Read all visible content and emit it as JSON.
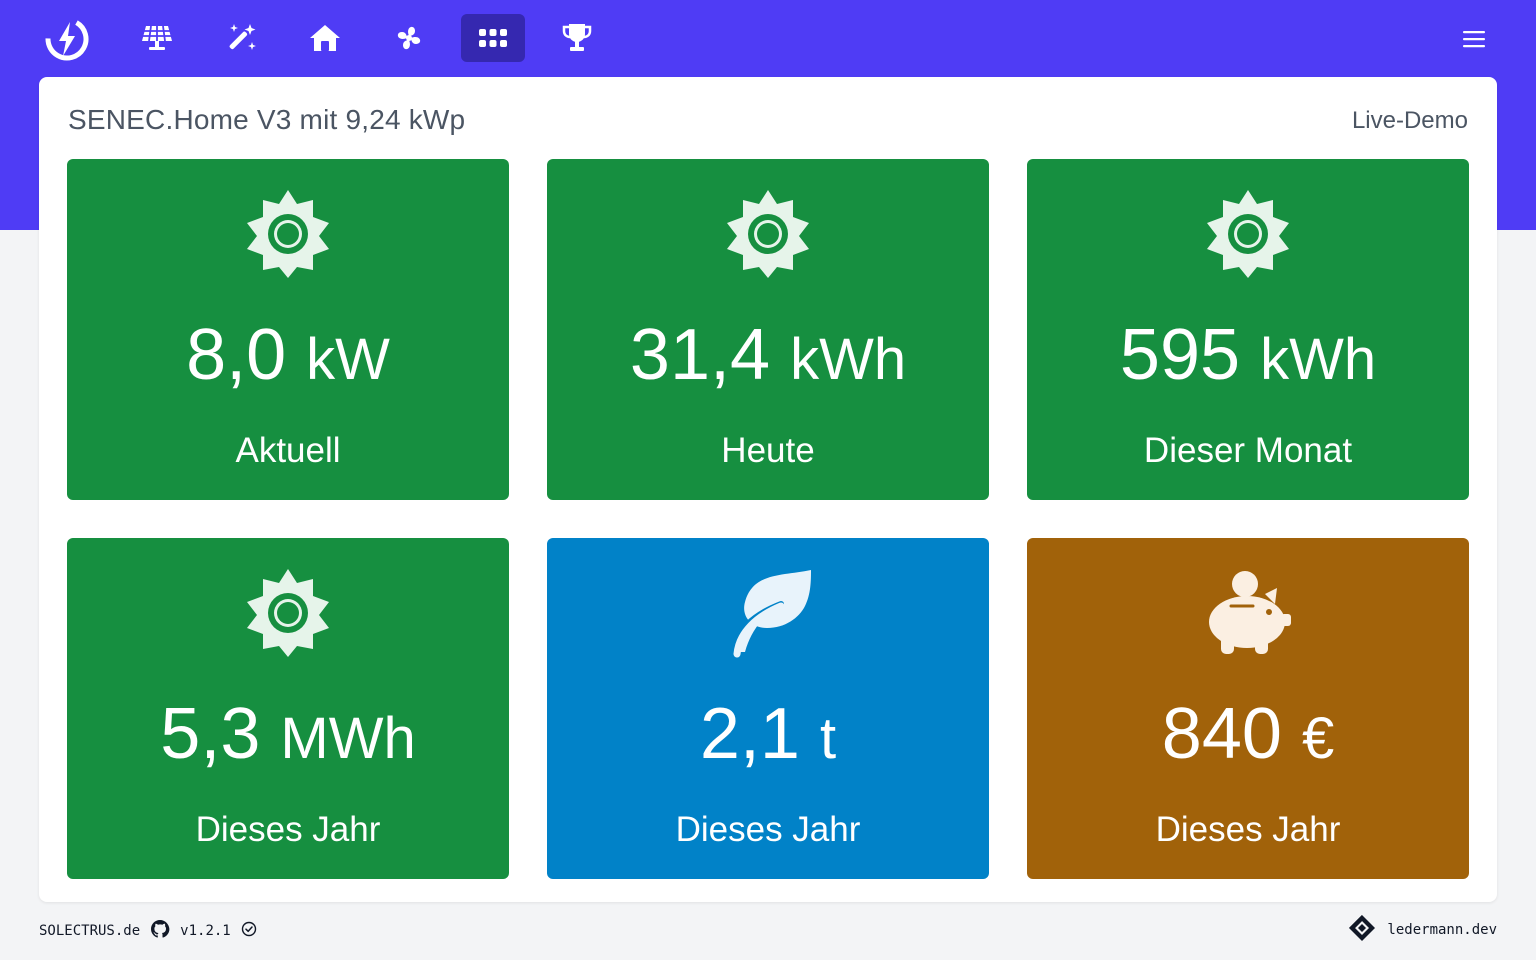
{
  "nav": {
    "items": [
      {
        "icon": "solar-panel-icon"
      },
      {
        "icon": "magic-wand-icon"
      },
      {
        "icon": "house-icon"
      },
      {
        "icon": "fan-icon"
      },
      {
        "icon": "grid-icon",
        "active": true
      },
      {
        "icon": "trophy-icon"
      }
    ],
    "menu_icon": "hamburger-menu-icon"
  },
  "header": {
    "title": "SENEC.Home V3 mit 9,24 kWp",
    "link": "Live-Demo"
  },
  "tiles": [
    {
      "icon": "sun-icon",
      "number": "8,0",
      "unit": "kW",
      "label": "Aktuell",
      "color": "#168f40"
    },
    {
      "icon": "sun-icon",
      "number": "31,4",
      "unit": "kWh",
      "label": "Heute",
      "color": "#168f40"
    },
    {
      "icon": "sun-icon",
      "number": "595",
      "unit": "kWh",
      "label": "Dieser Monat",
      "color": "#168f40"
    },
    {
      "icon": "sun-icon",
      "number": "5,3",
      "unit": "MWh",
      "label": "Dieses Jahr",
      "color": "#168f40"
    },
    {
      "icon": "leaf-icon",
      "number": "2,1",
      "unit": "t",
      "label": "Dieses Jahr",
      "color": "#0182c8"
    },
    {
      "icon": "piggy-bank-icon",
      "number": "840",
      "unit": "€",
      "label": "Dieses Jahr",
      "color": "#a1620a"
    }
  ],
  "footer": {
    "site": "SOLECTRUS.de",
    "version": "v1.2.1",
    "author": "ledermann.dev"
  },
  "colors": {
    "brand": "#4f3cf5",
    "nav_active": "#3528b0"
  }
}
